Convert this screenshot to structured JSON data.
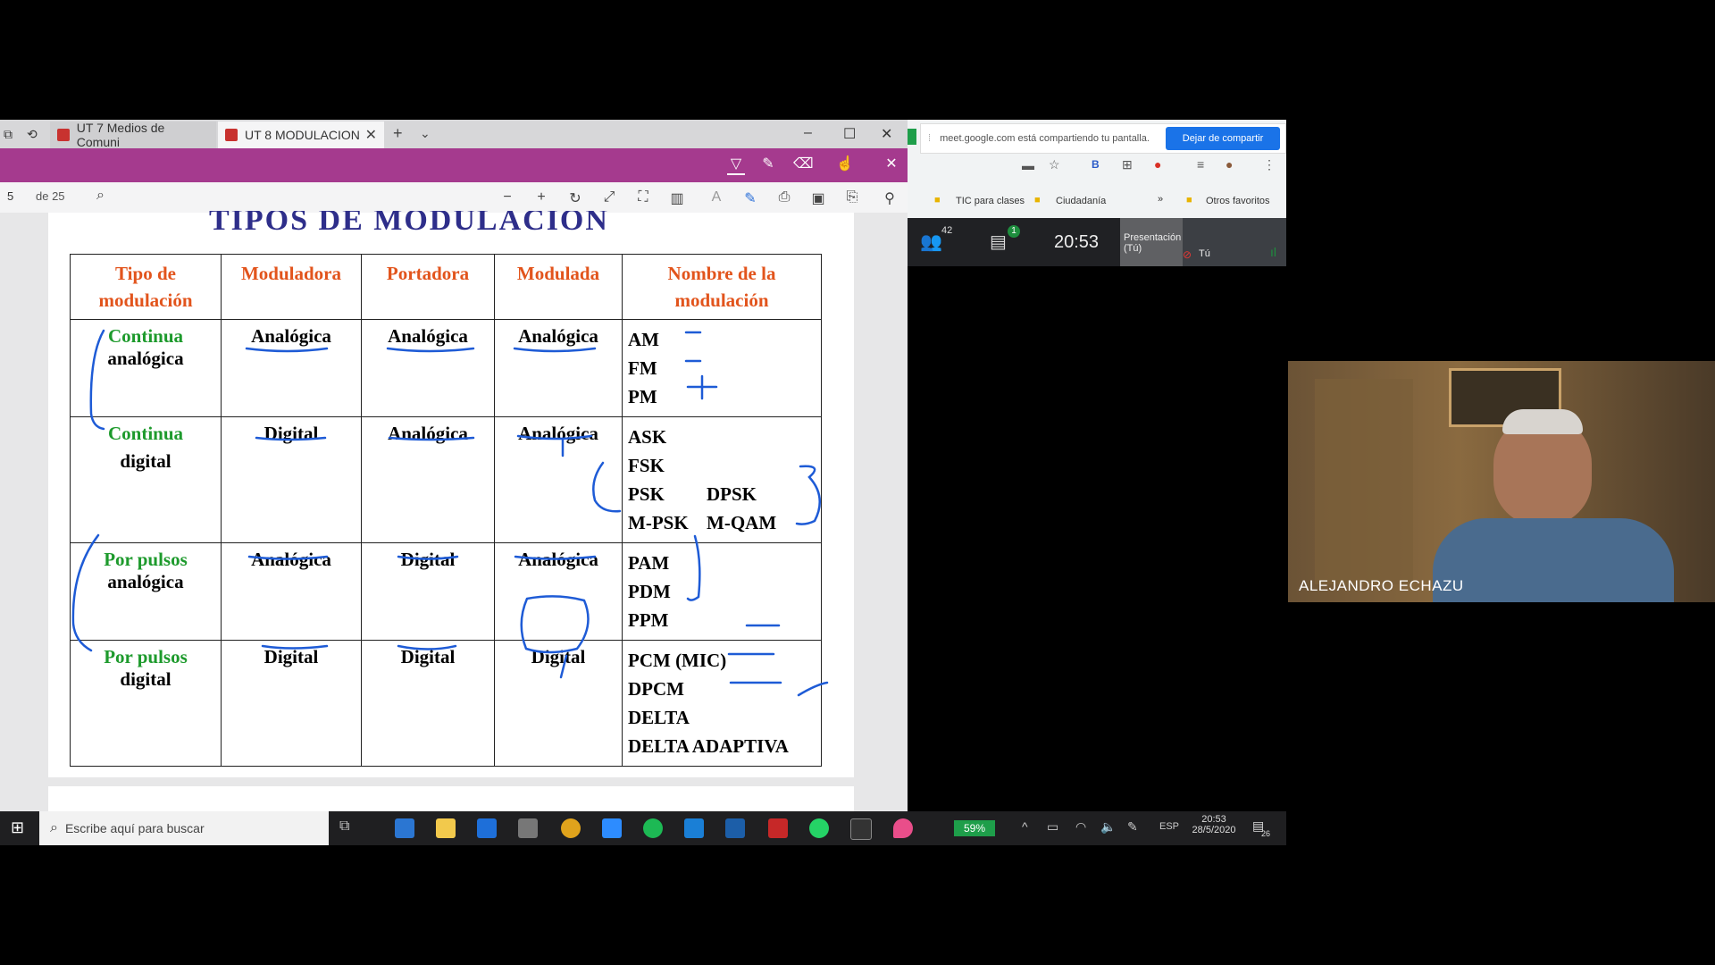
{
  "browser": {
    "tabs": [
      {
        "label": "UT 7 Medios de Comuni"
      },
      {
        "label": "UT 8 MODULACION"
      }
    ],
    "page_number": "5",
    "page_total": "de 25"
  },
  "document": {
    "title": "TIPOS DE MODULACIÓN",
    "headers": [
      "Tipo de modulación",
      "Moduladora",
      "Portadora",
      "Modulada",
      "Nombre de la modulación"
    ],
    "rows": [
      {
        "tipo_line1": "Continua",
        "tipo_line2": "analógica",
        "moduladora": "Analógica",
        "portadora": "Analógica",
        "modulada": "Analógica",
        "nombres": [
          "AM",
          "FM",
          "PM"
        ]
      },
      {
        "tipo_line1": "Continua",
        "tipo_line2": "digital",
        "moduladora": "Digital",
        "portadora": "Analógica",
        "modulada": "Analógica",
        "nombres": [
          "ASK",
          "FSK",
          "PSK",
          "DPSK",
          "M-PSK",
          "M-QAM"
        ]
      },
      {
        "tipo_line1": "Por pulsos",
        "tipo_line2": "analógica",
        "moduladora": "Analógica",
        "portadora": "Digital",
        "modulada": "Analógica",
        "nombres": [
          "PAM",
          "PDM",
          "PPM"
        ]
      },
      {
        "tipo_line1": "Por pulsos",
        "tipo_line2": "digital",
        "moduladora": "Digital",
        "portadora": "Digital",
        "modulada": "Digital",
        "nombres": [
          "PCM (MIC)",
          "DPCM",
          "DELTA",
          "DELTA ADAPTIVA"
        ]
      }
    ]
  },
  "taskbar": {
    "search_placeholder": "Escribe aquí para buscar",
    "battery": "59%",
    "language": "ESP",
    "time": "20:53",
    "date": "28/5/2020",
    "notifications": "26"
  },
  "meet": {
    "share_notice": "meet.google.com está compartiendo tu pantalla.",
    "stop_share": "Dejar de compartir",
    "bookmarks": [
      "TIC para clases",
      "Ciudadanía",
      "Otros favoritos"
    ],
    "participants": "42",
    "chat_count": "1",
    "clock": "20:53",
    "presentation_label": "Presentación (Tú)",
    "self_label": "Tú",
    "speaker_name": "ALEJANDRO ECHAZU"
  }
}
